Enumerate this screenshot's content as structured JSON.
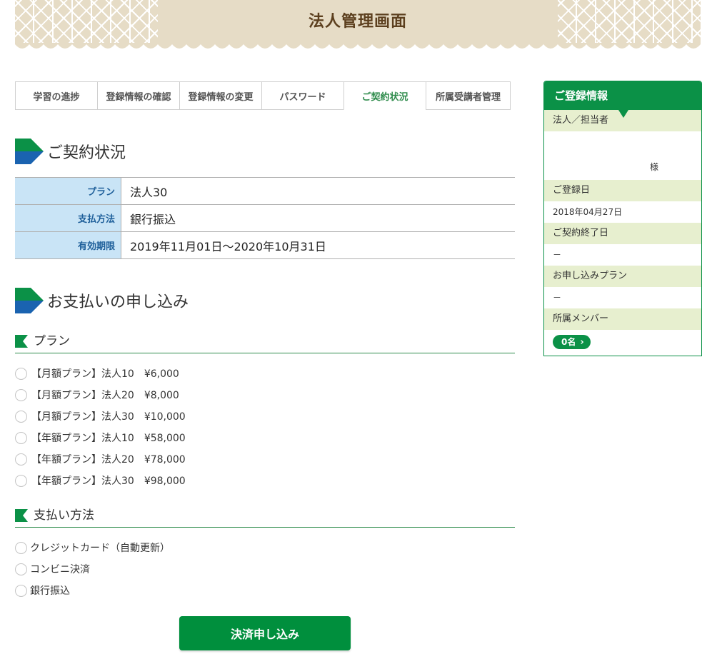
{
  "header": {
    "title": "法人管理画面"
  },
  "tabs": [
    {
      "label": "学習の進捗"
    },
    {
      "label": "登録情報の確認"
    },
    {
      "label": "登録情報の変更"
    },
    {
      "label": "パスワード"
    },
    {
      "label": "ご契約状況"
    },
    {
      "label": "所属受講者管理"
    }
  ],
  "contract": {
    "title": "ご契約状況",
    "rows": [
      {
        "label": "プラン",
        "value": "法人30"
      },
      {
        "label": "支払方法",
        "value": "銀行振込"
      },
      {
        "label": "有効期限",
        "value": "2019年11月01日～2020年10月31日"
      }
    ]
  },
  "payment": {
    "title": "お支払いの申し込み",
    "plan_heading": "プラン",
    "plans": [
      "【月額プラン】法人10　¥6,000",
      "【月額プラン】法人20　¥8,000",
      "【月額プラン】法人30　¥10,000",
      "【年額プラン】法人10　¥58,000",
      "【年額プラン】法人20　¥78,000",
      "【年額プラン】法人30　¥98,000"
    ],
    "method_heading": "支払い方法",
    "methods": [
      "クレジットカード（自動更新）",
      "コンビニ決済",
      "銀行振込"
    ],
    "submit_label": "決済申し込み"
  },
  "sidebar": {
    "title": "ご登録情報",
    "person_label": "法人／担当者",
    "person_suffix": "様",
    "registered_label": "ご登録日",
    "registered_value": "2018年04月27日",
    "contract_end_label": "ご契約終了日",
    "contract_end_value": "－",
    "applied_plan_label": "お申し込みプラン",
    "applied_plan_value": "－",
    "members_label": "所属メンバー",
    "members_badge": "0名"
  },
  "colors": {
    "brand_green": "#0b9147",
    "brand_blue": "#1a63b0",
    "header_beige": "#e6dcc6",
    "table_header_blue": "#c9e4f6",
    "sidebar_label_bg": "#e7efcf"
  }
}
